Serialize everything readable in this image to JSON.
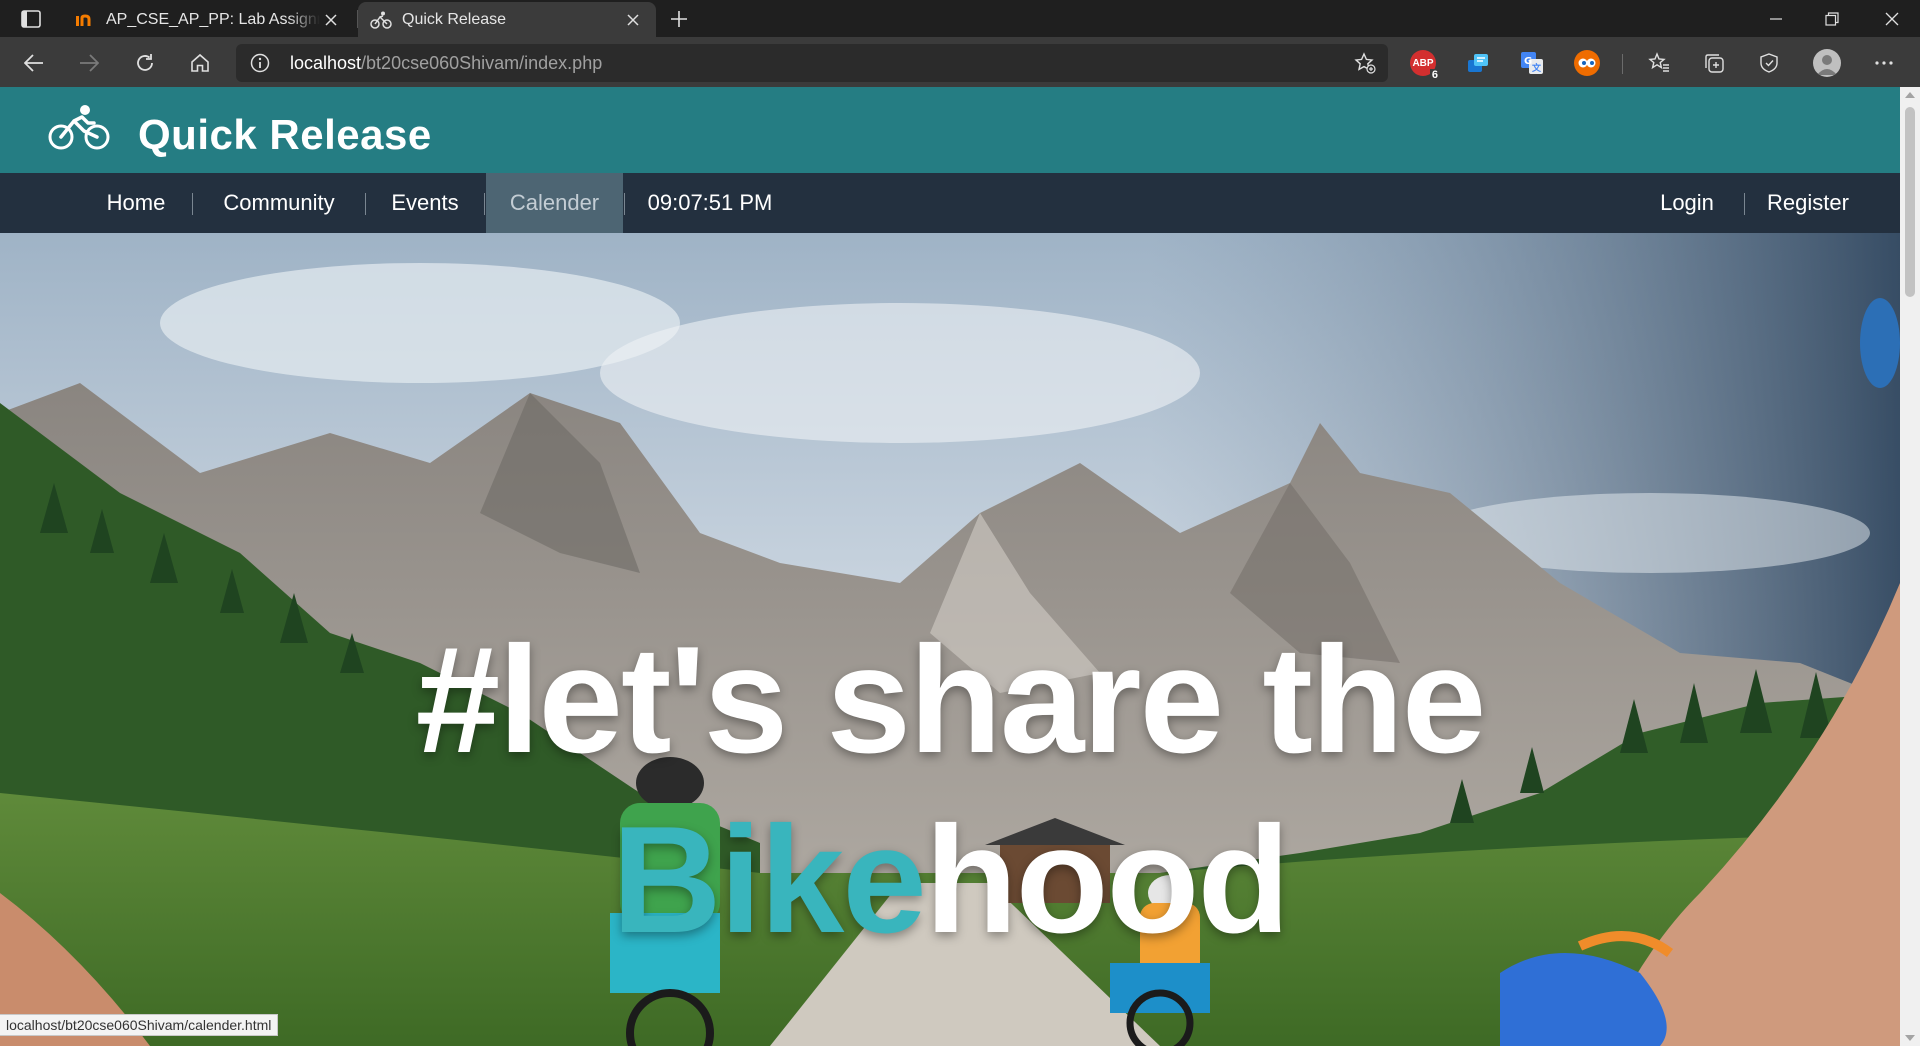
{
  "browser": {
    "tabs": [
      {
        "title": "AP_CSE_AP_PP: Lab Assignment",
        "favicon": "in-logo-icon",
        "active": false
      },
      {
        "title": "Quick Release",
        "favicon": "cyclist-icon",
        "active": true
      }
    ],
    "address": {
      "host": "localhost",
      "path": "/bt20cse060Shivam/index.php"
    },
    "extensions": [
      {
        "name": "adblock-icon",
        "badge": "6",
        "color": "#d32f2f"
      },
      {
        "name": "copy-extension-icon",
        "color": "#2196f3"
      },
      {
        "name": "translate-icon",
        "color": "#3367d6"
      },
      {
        "name": "eyes-extension-icon",
        "color": "#e65100"
      }
    ],
    "status_url": "localhost/bt20cse060Shivam/calender.html"
  },
  "site": {
    "title": "Quick Release",
    "header_color": "#257d83",
    "nav_color": "#23303f",
    "nav": {
      "items": [
        "Home",
        "Community",
        "Events",
        "Calender"
      ],
      "active": "Calender",
      "clock": "09:07:51 PM",
      "right_items": [
        "Login",
        "Register"
      ]
    },
    "hero": {
      "line1": "#let's share the",
      "accent": "Bike",
      "rest": "hood",
      "accent_color": "#39b5bd"
    }
  }
}
